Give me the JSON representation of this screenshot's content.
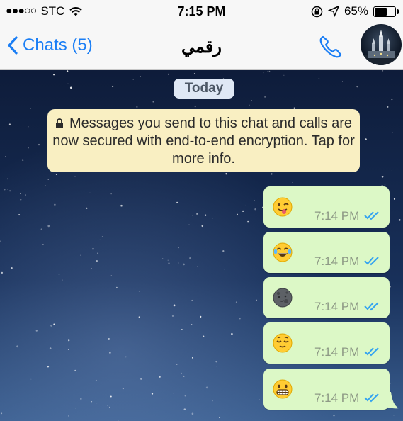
{
  "status_bar": {
    "signal_dots": "●●●○○",
    "carrier": "STC",
    "time": "7:15 PM",
    "battery_percent": "65%",
    "battery_level": 0.65
  },
  "nav": {
    "back_label": "Chats (5)",
    "title": "رقمي"
  },
  "chat": {
    "date_label": "Today",
    "encryption_notice": "Messages you send to this chat and calls are now secured with end-to-end encryption. Tap for more info.",
    "messages": [
      {
        "emoji": "winking-face-tongue",
        "time": "7:14 PM",
        "status": "read"
      },
      {
        "emoji": "face-tears-of-joy",
        "time": "7:14 PM",
        "status": "read"
      },
      {
        "emoji": "new-moon-face",
        "time": "7:14 PM",
        "status": "read"
      },
      {
        "emoji": "relieved-face",
        "time": "7:14 PM",
        "status": "read"
      },
      {
        "emoji": "grinning-face",
        "time": "7:14 PM",
        "status": "read"
      }
    ]
  },
  "colors": {
    "accent": "#1a7ef5",
    "outgoing_bubble": "#dcf8c6",
    "notice_bg": "#f9efc2",
    "read_ticks": "#34a3f0"
  }
}
